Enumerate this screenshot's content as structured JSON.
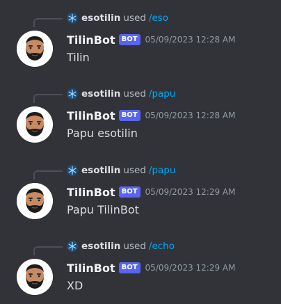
{
  "messages": [
    {
      "reply_user": "esotilin",
      "reply_used": "used",
      "reply_command": "/eso",
      "author": "TilinBot",
      "bot_tag": "BOT",
      "timestamp": "05/09/2023 12:28 AM",
      "content": "Tilin"
    },
    {
      "reply_user": "esotilin",
      "reply_used": "used",
      "reply_command": "/papu",
      "author": "TilinBot",
      "bot_tag": "BOT",
      "timestamp": "05/09/2023 12:28 AM",
      "content": "Papu esotilin"
    },
    {
      "reply_user": "esotilin",
      "reply_used": "used",
      "reply_command": "/papu",
      "author": "TilinBot",
      "bot_tag": "BOT",
      "timestamp": "05/09/2023 12:29 AM",
      "content": "Papu TilinBot"
    },
    {
      "reply_user": "esotilin",
      "reply_used": "used",
      "reply_command": "/echo",
      "author": "TilinBot",
      "bot_tag": "BOT",
      "timestamp": "05/09/2023 12:29 AM",
      "content": "XD"
    }
  ],
  "colors": {
    "background": "#313338",
    "command": "#00a8fc",
    "bot_tag": "#5865f2",
    "timestamp": "#949ba4"
  },
  "icons": {
    "reply_avatar": "snowflake-avatar-icon",
    "bot_avatar": "bearded-man-avatar-icon"
  }
}
